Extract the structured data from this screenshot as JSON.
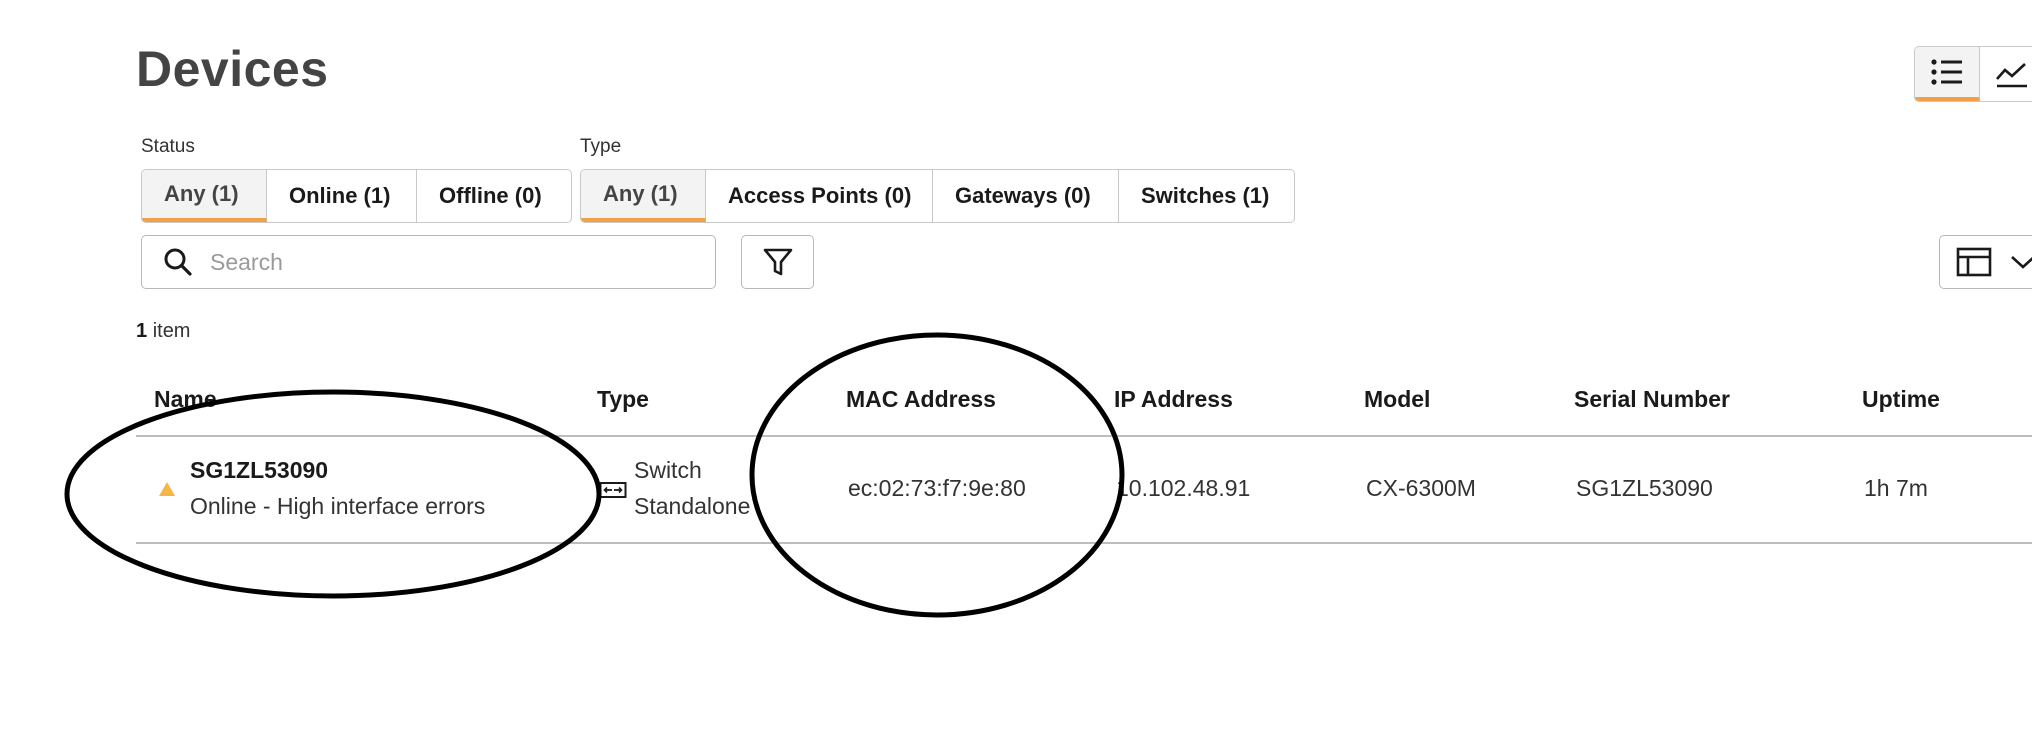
{
  "page": {
    "title": "Devices"
  },
  "view_toggle": {
    "items": [
      {
        "icon": "list-icon",
        "active": true
      },
      {
        "icon": "trend-chart-icon",
        "active": false
      }
    ]
  },
  "filters": {
    "status": {
      "label": "Status",
      "options": [
        "Any (1)",
        "Online (1)",
        "Offline (0)"
      ],
      "selected": "Any (1)"
    },
    "type": {
      "label": "Type",
      "options": [
        "Any (1)",
        "Access Points (0)",
        "Gateways (0)",
        "Switches (1)"
      ],
      "selected": "Any (1)"
    }
  },
  "search": {
    "placeholder": "Search",
    "value": ""
  },
  "results": {
    "count": "1",
    "count_label": "item"
  },
  "table": {
    "columns": [
      "Name",
      "Type",
      "MAC Address",
      "IP Address",
      "Model",
      "Serial Number",
      "Uptime"
    ],
    "rows": [
      {
        "name": "SG1ZL53090",
        "status": "Online - High interface errors",
        "status_color": "#f5b547",
        "type_line1": "Switch",
        "type_line2": "Standalone",
        "mac": "ec:02:73:f7:9e:80",
        "ip": "10.102.48.91",
        "model": "CX-6300M",
        "serial": "SG1ZL53090",
        "uptime": "1h 7m"
      }
    ]
  },
  "colors": {
    "accent": "#f0a046",
    "warning": "#f5b547",
    "border": "#c9c9c9"
  }
}
